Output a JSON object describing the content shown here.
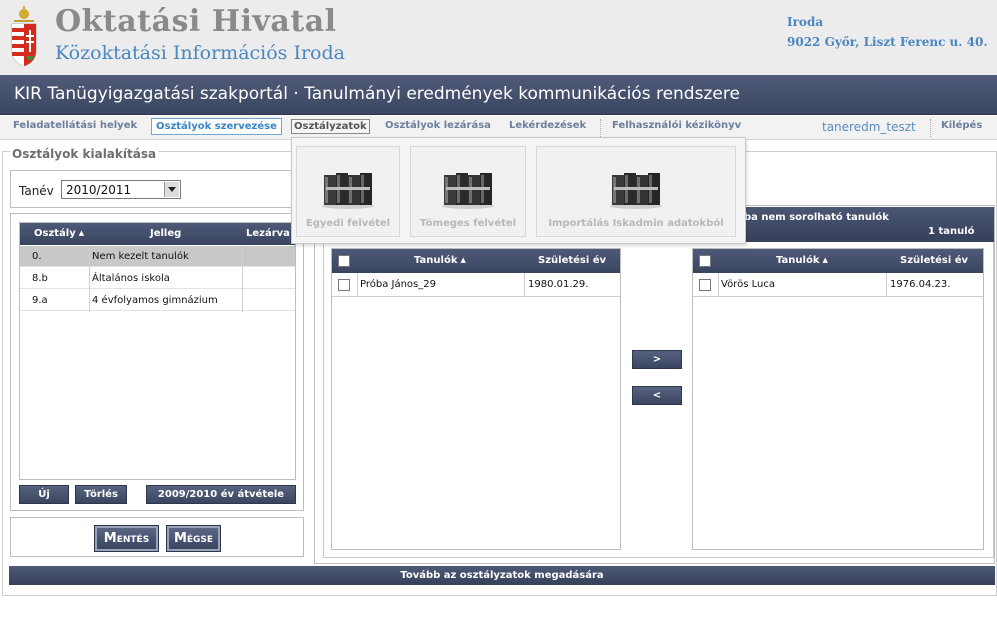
{
  "header": {
    "org_title": "Oktatási Hivatal",
    "org_subtitle": "Közoktatási Információs Iroda",
    "address_line1": "Iroda",
    "address_line2": "9022 Győr, Liszt Ferenc u. 40."
  },
  "portal_title": "KIR Tanügyigazgatási szakportál · Tanulmányi eredmények kommunikációs rendszere",
  "menu": {
    "items": [
      {
        "label": "Feladatellátási helyek"
      },
      {
        "label": "Osztályok szervezése"
      },
      {
        "label": "Osztályzatok"
      },
      {
        "label": "Osztályok lezárása"
      },
      {
        "label": "Lekérdezések"
      },
      {
        "label": "Felhasználói kézikönyv"
      }
    ],
    "user": "taneredm_teszt",
    "logout": "Kilépés"
  },
  "dropdown": {
    "items": [
      {
        "label": "Egyedi felvétel",
        "icon": "binders-icon"
      },
      {
        "label": "Tömeges felvétel",
        "icon": "binders-icon"
      },
      {
        "label": "Importálás Iskadmin adatokból",
        "icon": "binders-icon"
      }
    ]
  },
  "section": {
    "legend": "Osztályok kialakítása",
    "tanev_label": "Tanév",
    "tanev_value": "2010/2011"
  },
  "classes": {
    "headers": {
      "osztaly": "Osztály",
      "jelleg": "Jelleg",
      "lezarva": "Lezárva"
    },
    "rows": [
      {
        "osztaly": "0.",
        "jelleg": "Nem kezelt tanulók"
      },
      {
        "osztaly": "8.b",
        "jelleg": "Általános iskola"
      },
      {
        "osztaly": "9.a",
        "jelleg": "4 évfolyamos gimnázium"
      }
    ],
    "buttons": {
      "new": "Új",
      "delete": "Törlés",
      "take_over": "2009/2010 év átvétele"
    }
  },
  "actions": {
    "save": "Mentés",
    "cancel": "Mégse"
  },
  "unassigned": {
    "title_partial": "ba nem sorolható tanulók",
    "count": "1 tanuló"
  },
  "students_left": {
    "headers": {
      "name": "Tanulók",
      "birth": "Születési év"
    },
    "rows": [
      {
        "name": "Próba János_29",
        "birth": "1980.01.29."
      }
    ]
  },
  "students_right": {
    "headers": {
      "name": "Tanulók",
      "birth": "Születési év"
    },
    "rows": [
      {
        "name": "Vörös Luca",
        "birth": "1976.04.23."
      }
    ]
  },
  "move": {
    "right": ">",
    "left": "<"
  },
  "footer_button": "Tovább az osztályzatok megadására",
  "colors": {
    "navy": "#3b4662",
    "link_blue": "#4a86c0",
    "menu_active": "#3b85c6"
  }
}
